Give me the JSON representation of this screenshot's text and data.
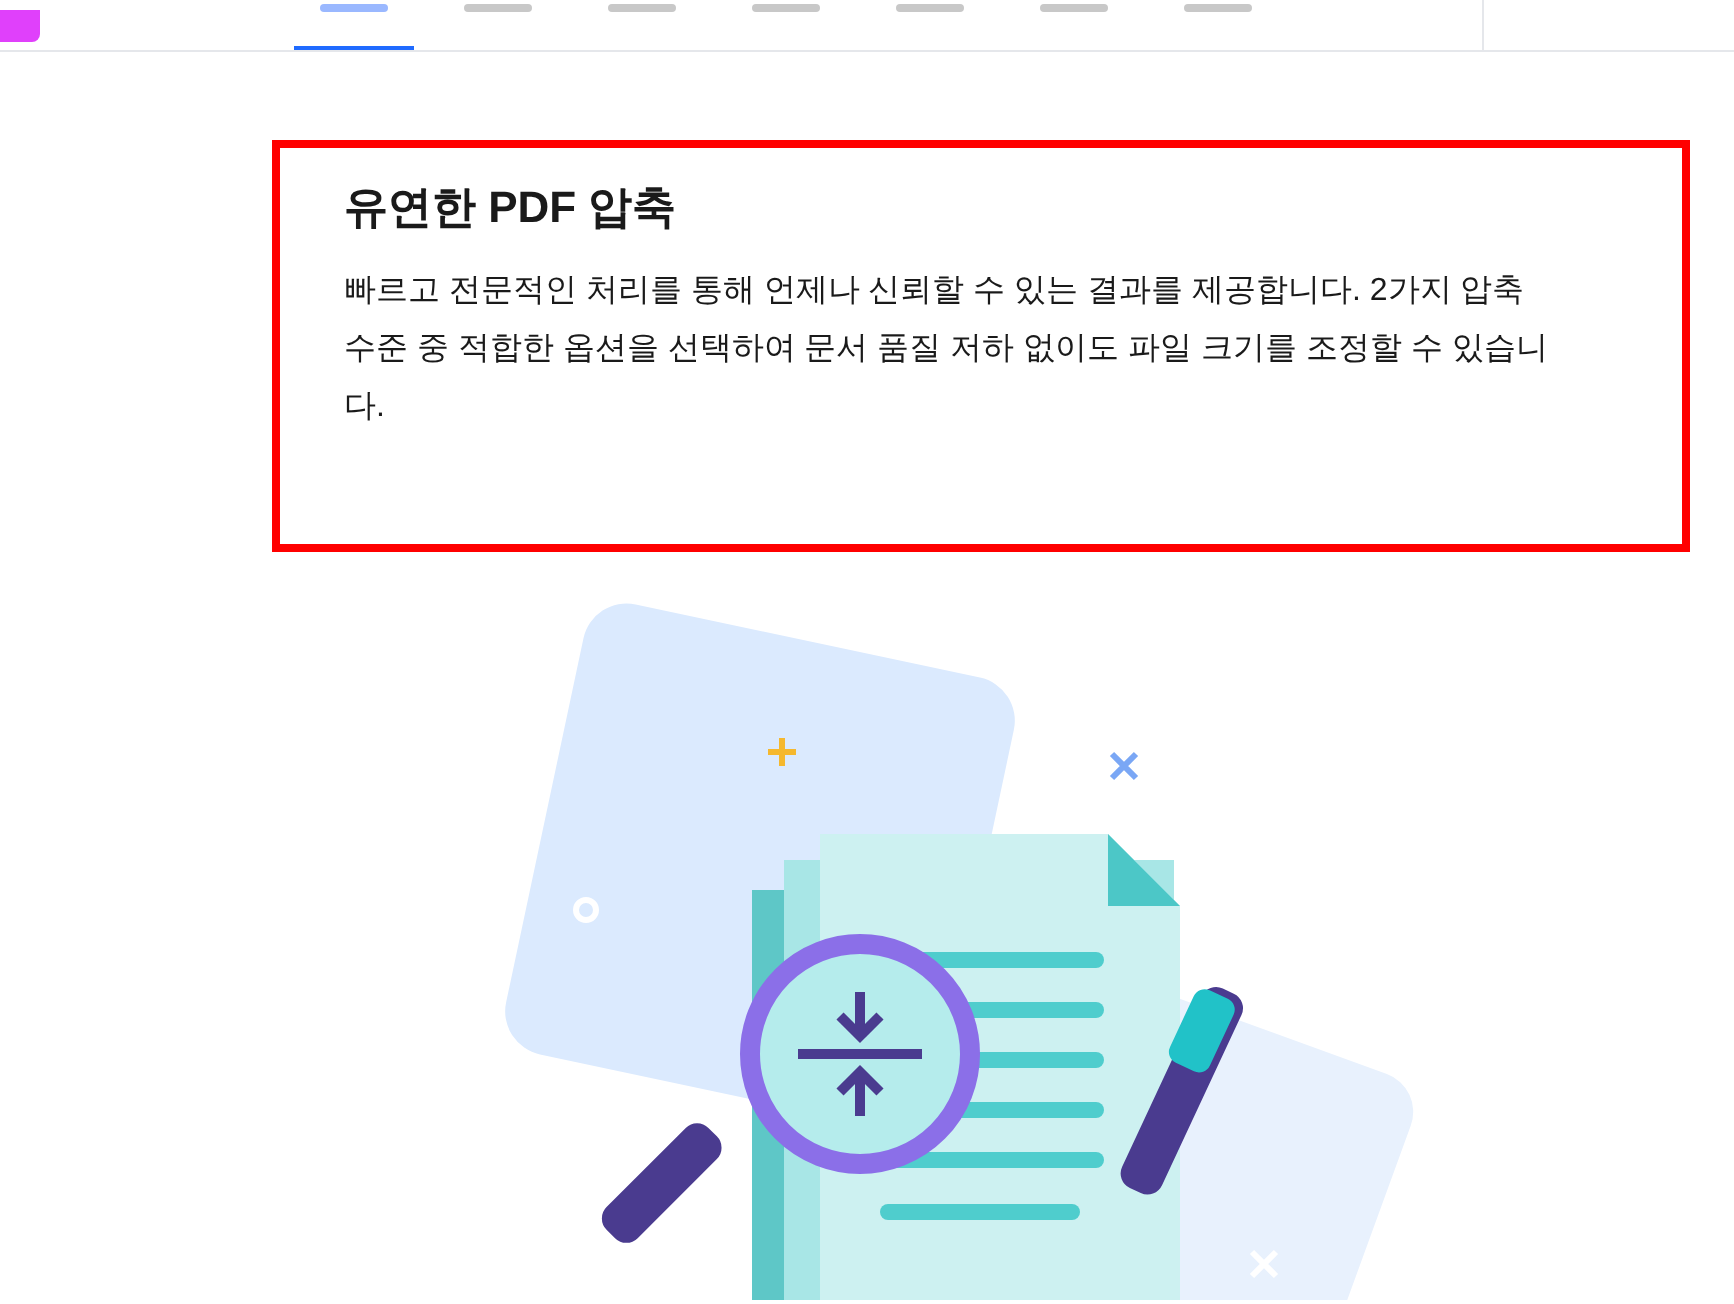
{
  "nav": {
    "tabs": [
      {
        "selected": true
      },
      {
        "selected": false
      },
      {
        "selected": false
      },
      {
        "selected": false
      },
      {
        "selected": false
      },
      {
        "selected": false
      },
      {
        "selected": false
      }
    ]
  },
  "section": {
    "title": "유연한 PDF 압축",
    "description": "빠르고 전문적인 처리를 통해 언제나 신뢰할 수 있는 결과를 제공합니다. 2가지 압축 수준 중 적합한 옵션을 선택하여 문서 품질 저하 없이도 파일 크기를 조정할 수 있습니다."
  }
}
